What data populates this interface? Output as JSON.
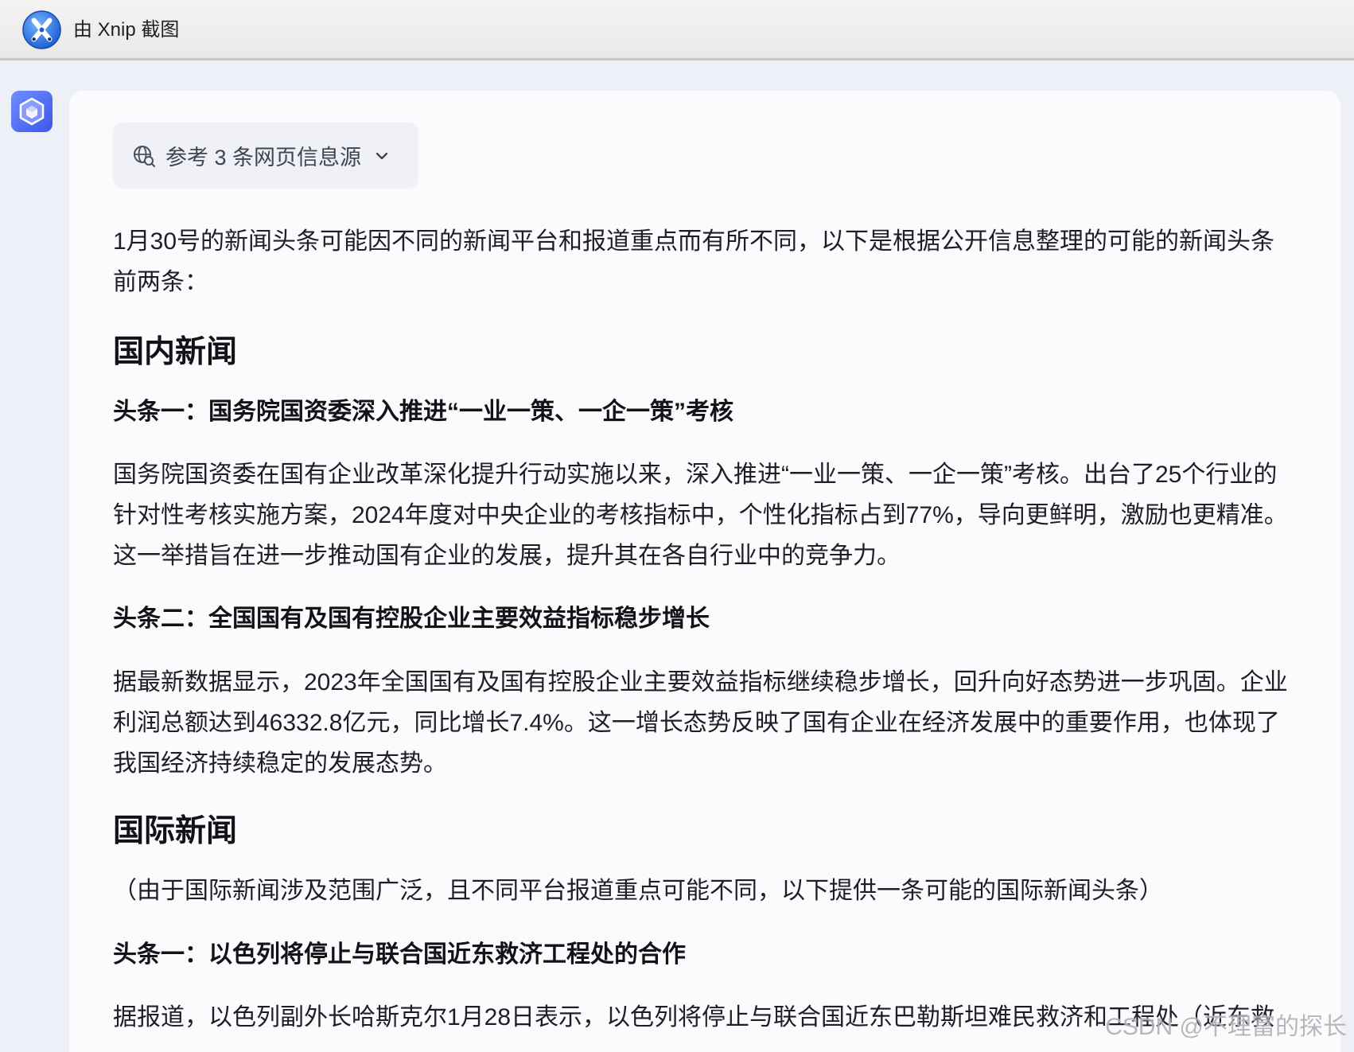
{
  "window": {
    "title": "由 Xnip 截图",
    "app_icon": "xnip-logo-icon"
  },
  "sidebar": {
    "avatar_icon": "assistant-cube-icon"
  },
  "message": {
    "sources_chip": {
      "label": "参考 3 条网页信息源",
      "icon": "globe-search-icon",
      "chevron": "chevron-down-icon"
    },
    "intro": [
      "1月30号的新闻头条可能因不同的新闻平台和报道重点而有所不同，以下是根据公开信息整理的可能的新闻头条",
      "前两条："
    ],
    "sections": [
      {
        "heading": "国内新闻",
        "items": [
          {
            "title": "头条一：国务院国资委深入推进“一业一策、一企一策”考核",
            "lines": [
              "国务院国资委在国有企业改革深化提升行动实施以来，深入推进“一业一策、一企一策”考核。出台了25个行业的",
              "针对性考核实施方案，2024年度对中央企业的考核指标中，个性化指标占到77%，导向更鲜明，激励也更精准。",
              "这一举措旨在进一步推动国有企业的发展，提升其在各自行业中的竞争力。"
            ]
          },
          {
            "title": "头条二：全国国有及国有控股企业主要效益指标稳步增长",
            "lines": [
              "据最新数据显示，2023年全国国有及国有控股企业主要效益指标继续稳步增长，回升向好态势进一步巩固。企业",
              "利润总额达到46332.8亿元，同比增长7.4%。这一增长态势反映了国有企业在经济发展中的重要作用，也体现了",
              "我国经济持续稳定的发展态势。"
            ]
          }
        ]
      },
      {
        "heading": "国际新闻",
        "note": "（由于国际新闻涉及范围广泛，且不同平台报道重点可能不同，以下提供一条可能的国际新闻头条）",
        "items": [
          {
            "title": "头条一：以色列将停止与联合国近东救济工程处的合作",
            "lines": [
              "据报道，以色列副外长哈斯克尔1月28日表示，以色列将停止与联合国近东巴勒斯坦难民救济和工程处（近东救"
            ]
          }
        ]
      }
    ]
  },
  "watermark": "CSDN @不理富的探长",
  "colors": {
    "page_bg": "#eef0f8",
    "card_bg": "#fbfbfe",
    "chip_bg": "#f0f1f6",
    "text": "#1d1f24",
    "accent": "#4a6cf7"
  }
}
